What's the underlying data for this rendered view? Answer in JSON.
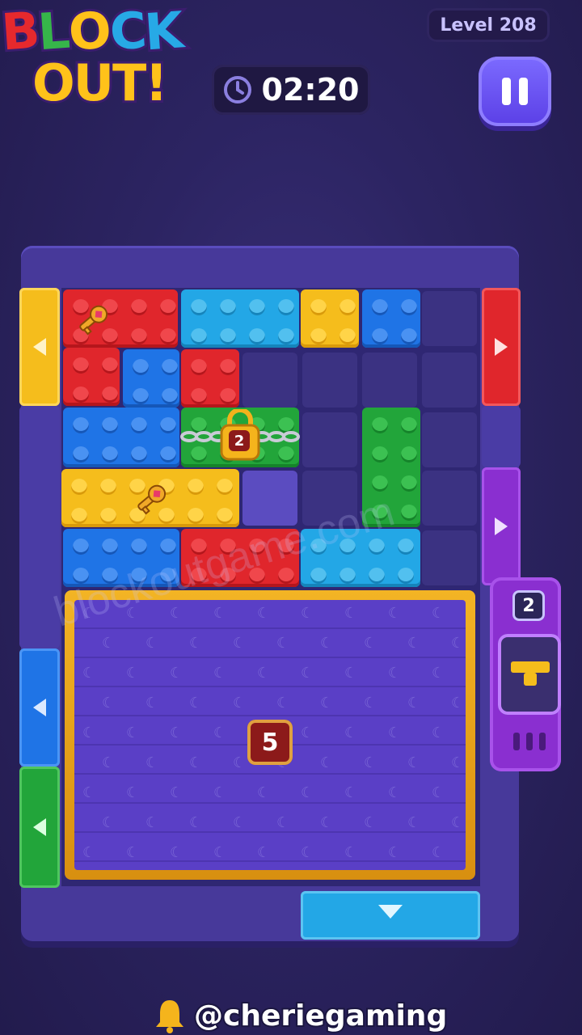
{
  "header": {
    "logo_line1": "BLOCK",
    "logo_line2": "OUT!",
    "level_label": "Level 208",
    "timer": "02:20",
    "pause_icon": "pause-icon"
  },
  "board": {
    "lock_count": "2",
    "mat_count": "5",
    "dispenser_count": "2",
    "watermark": "blockoutgame.com",
    "colors": {
      "red": "#e0262c",
      "blue": "#1f74e6",
      "cyan": "#23a7e6",
      "yellow": "#f5bd1c",
      "green": "#22a53a",
      "purple": "#8a2fd0"
    }
  },
  "footer": {
    "handle": "@cheriegaming"
  }
}
